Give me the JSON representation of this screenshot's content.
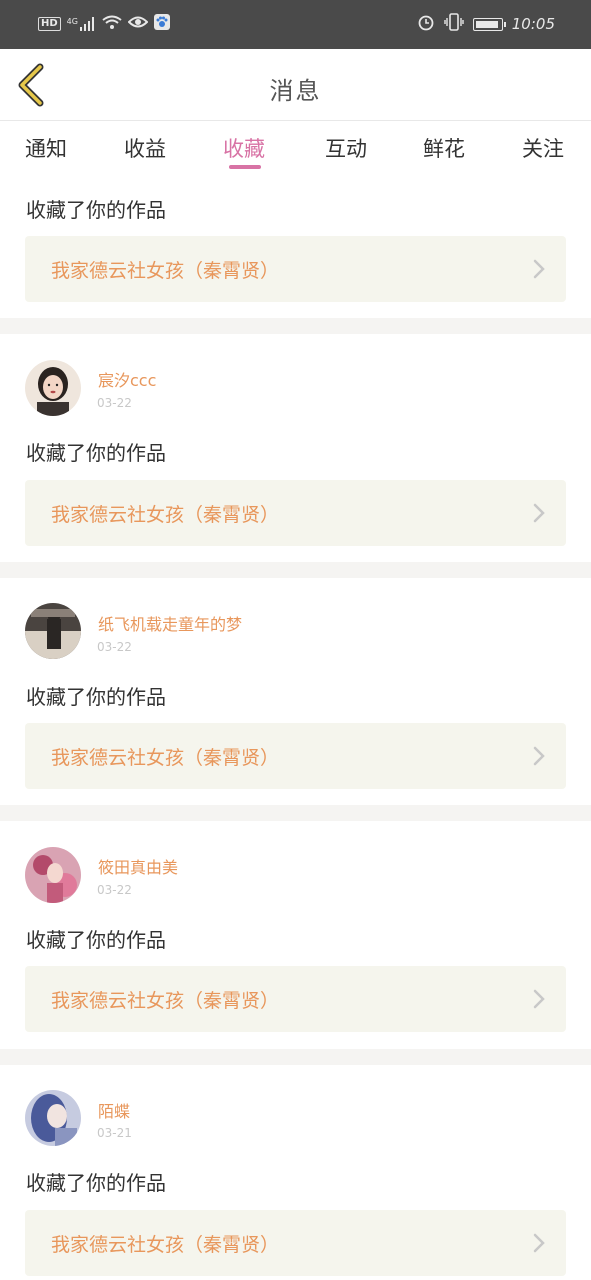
{
  "status_bar": {
    "hd": "HD",
    "signal": "4G",
    "time": "10:05",
    "battery_level": 0.85,
    "icons": [
      "signal-icon",
      "wifi-icon",
      "eye-icon",
      "paw-app-icon",
      "alarm-icon",
      "vibrate-icon",
      "battery-icon"
    ]
  },
  "header": {
    "title": "消息",
    "back_icon": "chevron-left-icon"
  },
  "tabs": [
    {
      "label": "通知",
      "active": false
    },
    {
      "label": "收益",
      "active": false
    },
    {
      "label": "收藏",
      "active": true
    },
    {
      "label": "互动",
      "active": false
    },
    {
      "label": "鲜花",
      "active": false
    },
    {
      "label": "关注",
      "active": false
    }
  ],
  "colors": {
    "accent": "#d873a5",
    "name": "#e8975c",
    "card_bg": "#f5f5ed",
    "status_bar": "#4a4a4a"
  },
  "partial_item": {
    "action": "收藏了你的作品",
    "work_title": "我家德云社女孩（秦霄贤）"
  },
  "items": [
    {
      "name": "宸汐ccc",
      "date": "03-22",
      "action": "收藏了你的作品",
      "work_title": "我家德云社女孩（秦霄贤）"
    },
    {
      "name": "纸飞机载走童年的梦",
      "date": "03-22",
      "action": "收藏了你的作品",
      "work_title": "我家德云社女孩（秦霄贤）"
    },
    {
      "name": "筱田真由美",
      "date": "03-22",
      "action": "收藏了你的作品",
      "work_title": "我家德云社女孩（秦霄贤）"
    },
    {
      "name": "陌蝶",
      "date": "03-21",
      "action": "收藏了你的作品",
      "work_title": "我家德云社女孩（秦霄贤）"
    }
  ]
}
